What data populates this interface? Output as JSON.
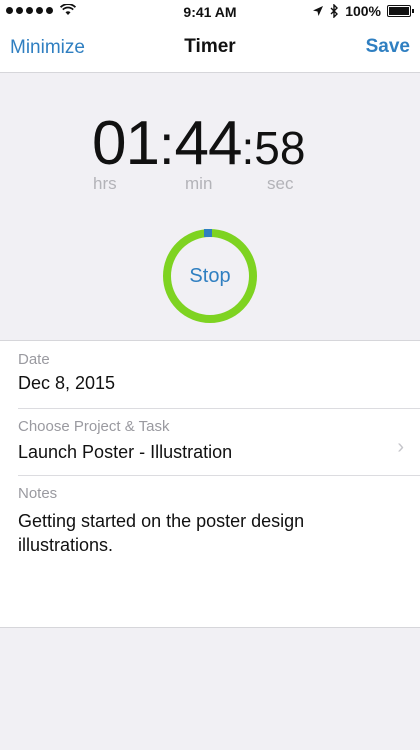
{
  "status_bar": {
    "time": "9:41 AM",
    "battery": "100%",
    "icons": [
      "signal-dots-icon",
      "wifi-icon",
      "location-arrow-icon",
      "bluetooth-icon",
      "battery-icon"
    ]
  },
  "nav": {
    "left": "Minimize",
    "title": "Timer",
    "right": "Save"
  },
  "timer": {
    "hours": "01",
    "minutes": "44",
    "seconds": "58",
    "hrs_label": "hrs",
    "min_label": "min",
    "sec_label": "sec",
    "stop_label": "Stop",
    "ring_color": "#7ed321",
    "marker_color": "#2f7fc1"
  },
  "form": {
    "date_label": "Date",
    "date_value": "Dec 8, 2015",
    "project_label": "Choose Project & Task",
    "project_value": "Launch Poster - Illustration",
    "notes_label": "Notes",
    "notes_value": "Getting started on the poster design illustrations."
  },
  "colors": {
    "accent": "#2f7fc1",
    "background": "#f1f0f4"
  }
}
